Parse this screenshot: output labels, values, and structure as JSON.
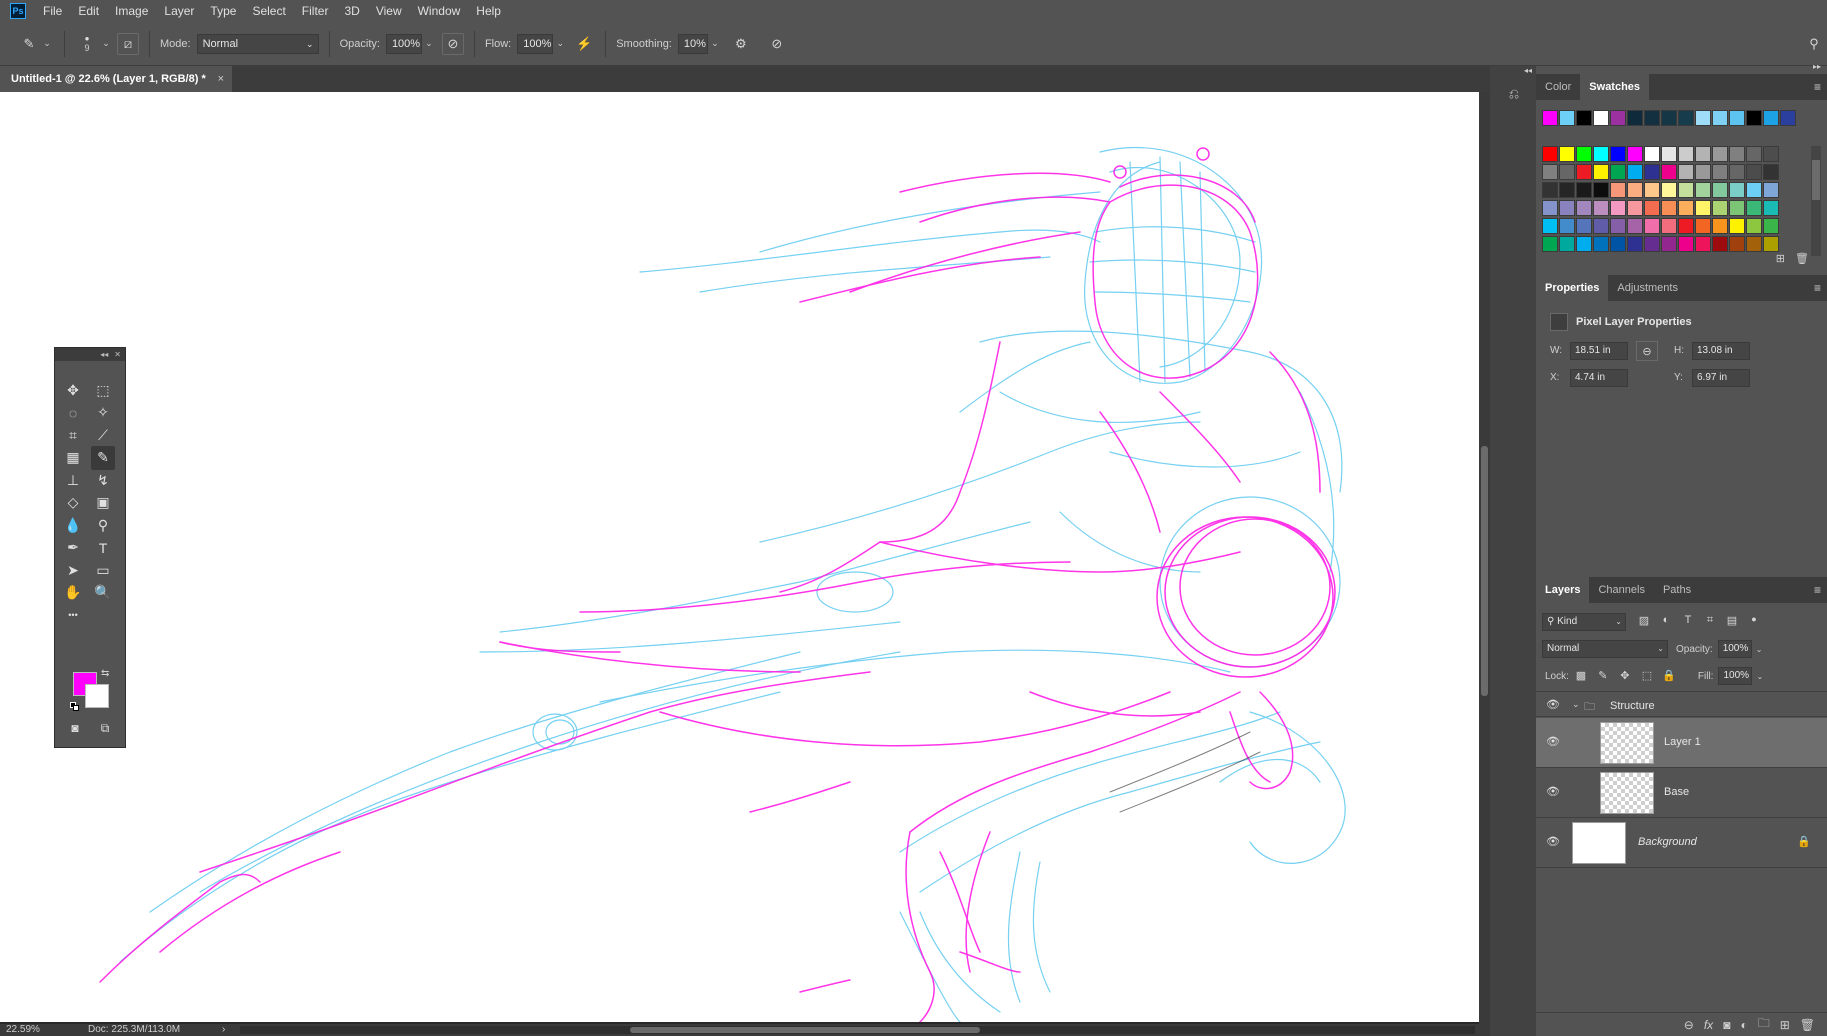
{
  "app": {
    "logo": "Ps"
  },
  "menu": [
    "File",
    "Edit",
    "Image",
    "Layer",
    "Type",
    "Select",
    "Filter",
    "3D",
    "View",
    "Window",
    "Help"
  ],
  "options": {
    "brush_size": "9",
    "mode_label": "Mode:",
    "mode_value": "Normal",
    "opacity_label": "Opacity:",
    "opacity_value": "100%",
    "flow_label": "Flow:",
    "flow_value": "100%",
    "smoothing_label": "Smoothing:",
    "smoothing_value": "10%"
  },
  "document": {
    "tab_title": "Untitled-1 @ 22.6% (Layer 1, RGB/8) *",
    "close": "×"
  },
  "status": {
    "zoom": "22.59%",
    "doc": "Doc: 225.3M/113.0M",
    "arrow": "›"
  },
  "toolbox": {
    "foreground_color": "#ff00ff",
    "background_color": "#ffffff",
    "tools": [
      {
        "name": "move-tool-icon",
        "glyph": "✥"
      },
      {
        "name": "marquee-tool-icon",
        "glyph": "⬚"
      },
      {
        "name": "lasso-tool-icon",
        "glyph": "◌"
      },
      {
        "name": "magic-wand-tool-icon",
        "glyph": "✧"
      },
      {
        "name": "crop-tool-icon",
        "glyph": "⌗"
      },
      {
        "name": "eyedropper-tool-icon",
        "glyph": "⟋"
      },
      {
        "name": "healing-brush-tool-icon",
        "glyph": "▦"
      },
      {
        "name": "brush-tool-icon",
        "glyph": "✎"
      },
      {
        "name": "clone-stamp-tool-icon",
        "glyph": "⊥"
      },
      {
        "name": "history-brush-tool-icon",
        "glyph": "↯"
      },
      {
        "name": "eraser-tool-icon",
        "glyph": "◇"
      },
      {
        "name": "gradient-tool-icon",
        "glyph": "▣"
      },
      {
        "name": "blur-tool-icon",
        "glyph": "💧"
      },
      {
        "name": "dodge-tool-icon",
        "glyph": "⚲"
      },
      {
        "name": "pen-tool-icon",
        "glyph": "✒"
      },
      {
        "name": "type-tool-icon",
        "glyph": "T"
      },
      {
        "name": "path-selection-tool-icon",
        "glyph": "➤"
      },
      {
        "name": "rectangle-tool-icon",
        "glyph": "▭"
      },
      {
        "name": "hand-tool-icon",
        "glyph": "✋"
      },
      {
        "name": "zoom-tool-icon",
        "glyph": "🔍"
      },
      {
        "name": "more-tools-icon",
        "glyph": "•••"
      }
    ]
  },
  "panels": {
    "color_tabs": [
      "Color",
      "Swatches"
    ],
    "recent_swatches": [
      "#ff00ff",
      "#6ecff6",
      "#000000",
      "#ffffff",
      "#9b30a0",
      "#0f2a3a",
      "#12303f",
      "#143645",
      "#173c4b",
      "#9fdcf7",
      "#7fd0f5",
      "#5dc4f2",
      "#000000",
      "#1ea2e6",
      "#2a3f9e"
    ],
    "swatch_rows": [
      [
        "#ff0000",
        "#ffff00",
        "#00ff00",
        "#00ffff",
        "#0000ff",
        "#ff00ff",
        "#ffffff",
        "#e6e6e6",
        "#cccccc",
        "#b3b3b3",
        "#999999",
        "#808080",
        "#666666",
        "#4d4d4d"
      ],
      [
        "#808080",
        "#666666",
        "#ed1c24",
        "#fff200",
        "#00a651",
        "#00aeef",
        "#2e3192",
        "#ec008c",
        "#b3b3b3",
        "#999999",
        "#7f7f7f",
        "#666666",
        "#4c4c4c",
        "#333333"
      ],
      [
        "#333333",
        "#262626",
        "#1a1a1a",
        "#0d0d0d",
        "#f7977a",
        "#f9ad81",
        "#fdc68a",
        "#fff79a",
        "#c4df9b",
        "#a2d39c",
        "#82ca9d",
        "#7bcdc8",
        "#6ecff6",
        "#7ea7d8"
      ],
      [
        "#8493ca",
        "#8882be",
        "#a187be",
        "#bc8dbf",
        "#f49ac2",
        "#f6989d",
        "#f26c4f",
        "#f68e55",
        "#fbaf5c",
        "#fff467",
        "#acd372",
        "#7cc576",
        "#3bb878",
        "#1abbb4"
      ],
      [
        "#00bff3",
        "#438ccb",
        "#5574b9",
        "#605ca8",
        "#855fa8",
        "#a763a8",
        "#f06ea9",
        "#f26d7d",
        "#ed1c24",
        "#f26522",
        "#f7941d",
        "#fff200",
        "#8dc63f",
        "#39b54a"
      ],
      [
        "#00a651",
        "#00a99d",
        "#00aeef",
        "#0072bc",
        "#0054a6",
        "#2e3192",
        "#662d91",
        "#92278f",
        "#ec008c",
        "#ed145b",
        "#9e0b0f",
        "#a0410d",
        "#a36209",
        "#aba000"
      ]
    ],
    "properties_tabs": [
      "Properties",
      "Adjustments"
    ],
    "properties_title": "Pixel Layer Properties",
    "props": {
      "w_label": "W:",
      "w_value": "18.51 in",
      "h_label": "H:",
      "h_value": "13.08 in",
      "x_label": "X:",
      "x_value": "4.74 in",
      "y_label": "Y:",
      "y_value": "6.97 in"
    },
    "layers_tabs": [
      "Layers",
      "Channels",
      "Paths"
    ],
    "layers": {
      "kind_value": "Kind",
      "blend_value": "Normal",
      "opacity_label": "Opacity:",
      "opacity_value": "100%",
      "lock_label": "Lock:",
      "fill_label": "Fill:",
      "fill_value": "100%",
      "group_name": "Structure",
      "items": [
        {
          "name": "Layer 1"
        },
        {
          "name": "Base"
        },
        {
          "name": "Background"
        }
      ]
    }
  }
}
